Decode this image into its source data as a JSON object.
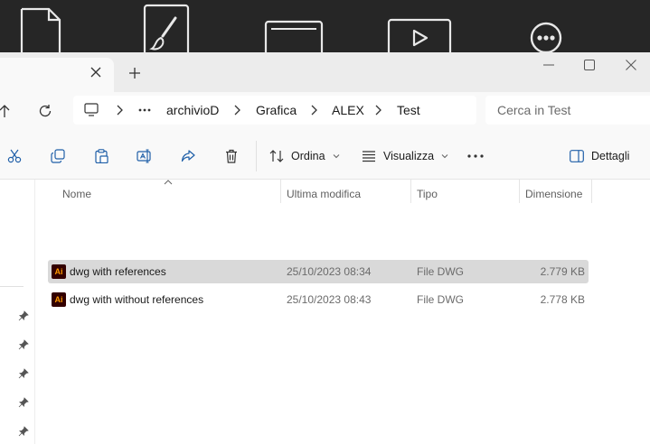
{
  "desktop": {
    "icons": [
      "document-icon",
      "paint-brush-icon",
      "browser-window-icon",
      "video-player-icon",
      "more-options-icon"
    ]
  },
  "tab": {
    "title": ""
  },
  "address": {
    "crumbs": [
      "archivioD",
      "Grafica",
      "ALEX",
      "Test"
    ]
  },
  "search": {
    "placeholder": "Cerca in Test"
  },
  "toolbar": {
    "sort_label": "Ordina",
    "view_label": "Visualizza",
    "details_label": "Dettagli"
  },
  "columns": {
    "name": "Nome",
    "modified": "Ultima modifica",
    "type": "Tipo",
    "size": "Dimensione"
  },
  "files": [
    {
      "icon_text": "Ai",
      "name": "dwg with references",
      "modified": "25/10/2023 08:34",
      "type": "File DWG",
      "size": "2.779 KB",
      "selected": true
    },
    {
      "icon_text": "Ai",
      "name": "dwg with without references",
      "modified": "25/10/2023 08:43",
      "type": "File DWG",
      "size": "2.778 KB",
      "selected": false
    }
  ],
  "colors": {
    "selection": "#d9d9d9",
    "ai_icon_bg": "#330000",
    "ai_icon_fg": "#ff9a00"
  }
}
